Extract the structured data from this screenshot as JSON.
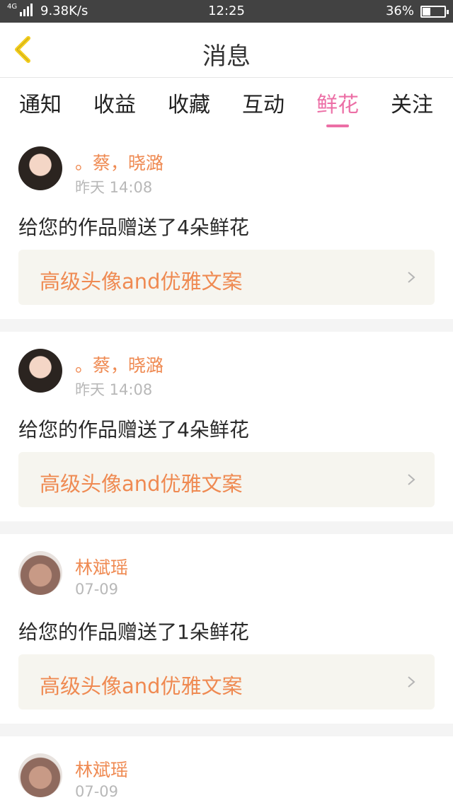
{
  "status_bar": {
    "network": "4G",
    "speed": "9.38K/s",
    "time": "12:25",
    "battery": "36%",
    "battery_level": 0.36
  },
  "header": {
    "title": "消息",
    "back_icon": "chevron-left-icon",
    "accent_color": "#f2cc1d"
  },
  "tabs": [
    {
      "label": "通知",
      "active": false
    },
    {
      "label": "收益",
      "active": false
    },
    {
      "label": "收藏",
      "active": false
    },
    {
      "label": "互动",
      "active": false
    },
    {
      "label": "鲜花",
      "active": true
    },
    {
      "label": "关注",
      "active": false
    }
  ],
  "colors": {
    "active_tab": "#ec6fa6",
    "name": "#ef8a52",
    "timestamp": "#b8b8b8",
    "link_bg": "#f6f5ef"
  },
  "messages": [
    {
      "name": "。蔡，晓潞",
      "time": "昨天 14:08",
      "text": "给您的作品赠送了4朵鲜花",
      "work": "高级头像and优雅文案"
    },
    {
      "name": "。蔡，晓潞",
      "time": "昨天 14:08",
      "text": "给您的作品赠送了4朵鲜花",
      "work": "高级头像and优雅文案"
    },
    {
      "name": "林斌瑶",
      "time": "07-09",
      "text": "给您的作品赠送了1朵鲜花",
      "work": "高级头像and优雅文案"
    },
    {
      "name": "林斌瑶",
      "time": "07-09",
      "text": "",
      "work": ""
    }
  ]
}
